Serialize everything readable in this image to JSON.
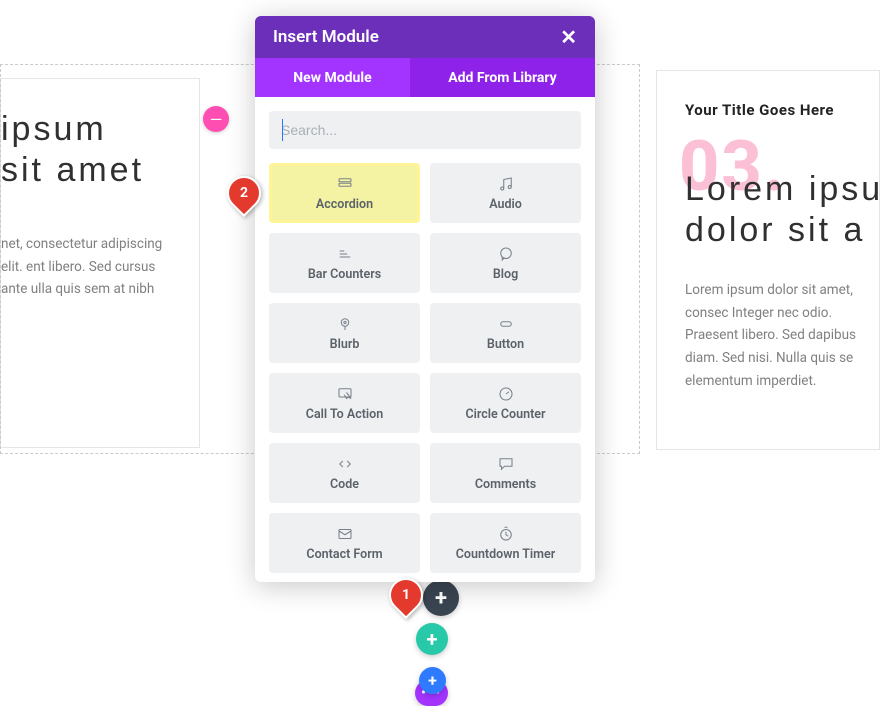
{
  "bg_left": {
    "title_line1": "ipsum",
    "title_line2": "sit amet",
    "body": "net, consectetur adipiscing elit. ent libero. Sed cursus ante ulla quis sem at nibh"
  },
  "bg_right": {
    "eyebrow": "Your Title Goes Here",
    "number": "03.",
    "title_line1": "Lorem ipsu",
    "title_line2": "dolor sit a",
    "body": "Lorem ipsum dolor sit amet, consec Integer nec odio. Praesent libero. Sed dapibus diam. Sed nisi. Nulla quis se elementum imperdiet."
  },
  "modal": {
    "title": "Insert Module",
    "tabs": {
      "new": "New Module",
      "library": "Add From Library"
    },
    "search_placeholder": "Search...",
    "modules": [
      {
        "label": "Accordion",
        "icon": "cards",
        "highlight": true
      },
      {
        "label": "Audio",
        "icon": "music"
      },
      {
        "label": "Bar Counters",
        "icon": "bars"
      },
      {
        "label": "Blog",
        "icon": "chat"
      },
      {
        "label": "Blurb",
        "icon": "pin"
      },
      {
        "label": "Button",
        "icon": "button"
      },
      {
        "label": "Call To Action",
        "icon": "select"
      },
      {
        "label": "Circle Counter",
        "icon": "gauge"
      },
      {
        "label": "Code",
        "icon": "code"
      },
      {
        "label": "Comments",
        "icon": "comment"
      },
      {
        "label": "Contact Form",
        "icon": "mail"
      },
      {
        "label": "Countdown Timer",
        "icon": "timer"
      }
    ],
    "modules_tail": [
      {
        "icon": "divider"
      },
      {
        "icon": "rss"
      }
    ]
  },
  "callouts": {
    "one": "1",
    "two": "2"
  },
  "fabs": {
    "dark": "+",
    "teal": "+",
    "blue": "+",
    "purple": "•••"
  },
  "neg_circle": "—"
}
